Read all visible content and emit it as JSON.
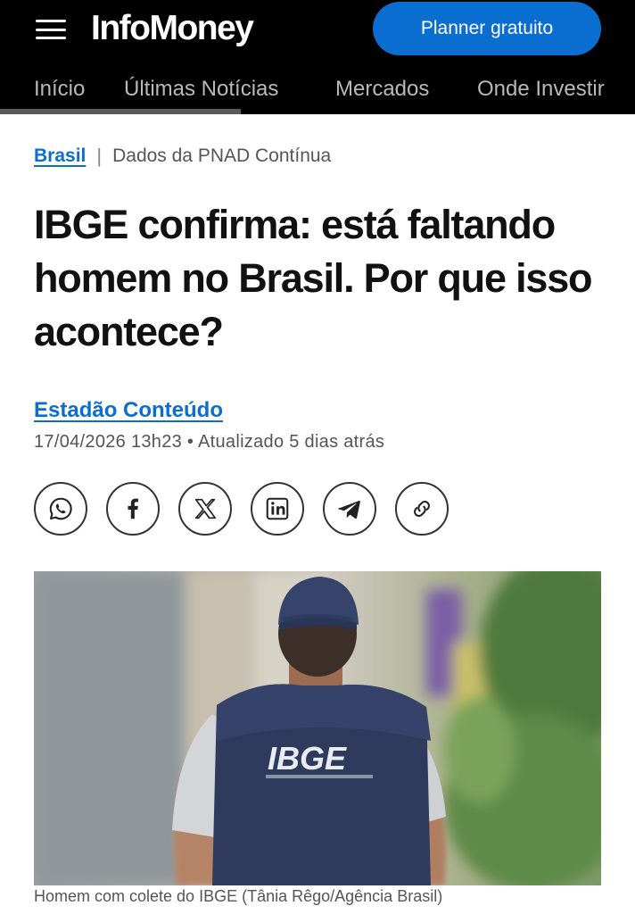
{
  "header": {
    "logo": "InfoMoney",
    "cta_label": "Planner gratuito",
    "menu_icon": "hamburger-menu-icon",
    "nav": [
      "Início",
      "Últimas Notícias",
      "Mercados",
      "Onde Investir"
    ]
  },
  "breadcrumb": {
    "section": "Brasil",
    "separator": "|",
    "topic": "Dados da PNAD Contínua"
  },
  "article": {
    "title": "IBGE confirma: está faltando homem no Brasil. Por que isso acontece?",
    "author": "Estadão Conteúdo",
    "meta": "17/04/2026 13h23 • Atualizado 5 dias atrás",
    "share_icons": [
      "whatsapp-icon",
      "facebook-icon",
      "x-icon",
      "linkedin-icon",
      "telegram-icon",
      "copy-link-icon"
    ],
    "image_vest_text": "IBGE",
    "caption": "Homem com colete do IBGE (Tânia Rêgo/Agência Brasil)"
  },
  "colors": {
    "accent": "#0a6ed1",
    "header_bg": "#000000"
  }
}
